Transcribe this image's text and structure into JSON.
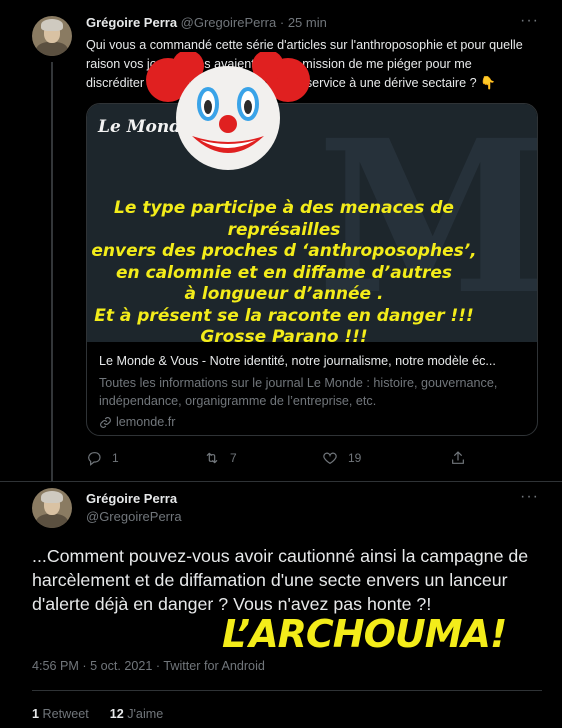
{
  "tweet1": {
    "author_name": "Grégoire Perra",
    "author_handle": "@GregoirePerra",
    "time_ago": "· 25 min",
    "more": "···",
    "text": "Qui vous a commandé cette série d'articles sur l'anthroposophie et pour quelle raison vos journalistes avaient ils pour mission de me piéger pour me discréditer publiquement, rendant ainsi service à une dérive sectaire ? 👇",
    "card": {
      "logo": "Le Monde",
      "title": "Le Monde & Vous - Notre identité, notre journalisme, notre modèle éc...",
      "description": "Toutes les informations sur le journal Le Monde : histoire, gouvernance, indépendance, organigramme de l’entreprise, etc.",
      "domain": "lemonde.fr"
    },
    "actions": {
      "reply_count": "1",
      "retweet_count": "7",
      "like_count": "19"
    }
  },
  "overlay": {
    "lines": [
      "Le type participe à des menaces de représailles",
      "envers des proches d ‘anthroposophes’,",
      "en calomnie et en diffame d’autres",
      "à longueur d’année .",
      "Et à présent se la raconte en danger !!!",
      "Grosse Parano !!!"
    ],
    "archouma": "L’ARCHOUMA!"
  },
  "tweet2": {
    "author_name": "Grégoire Perra",
    "author_handle": "@GregoirePerra",
    "more": "···",
    "text": "...Comment pouvez-vous avoir cautionné ainsi la campagne de harcèlement et de diffamation d'une secte envers un lanceur d'alerte déjà en danger ? Vous n'avez pas honte ?!",
    "timestamp": "4:56 PM · 5 oct. 2021 · Twitter for Android",
    "stats": {
      "retweets_count": "1",
      "retweets_label": "Retweet",
      "likes_count": "12",
      "likes_label": "J'aime"
    }
  },
  "colors": {
    "background": "#000000",
    "text_primary": "#e7e9ea",
    "text_secondary": "#71767b",
    "overlay_yellow": "#f3ec1a"
  }
}
